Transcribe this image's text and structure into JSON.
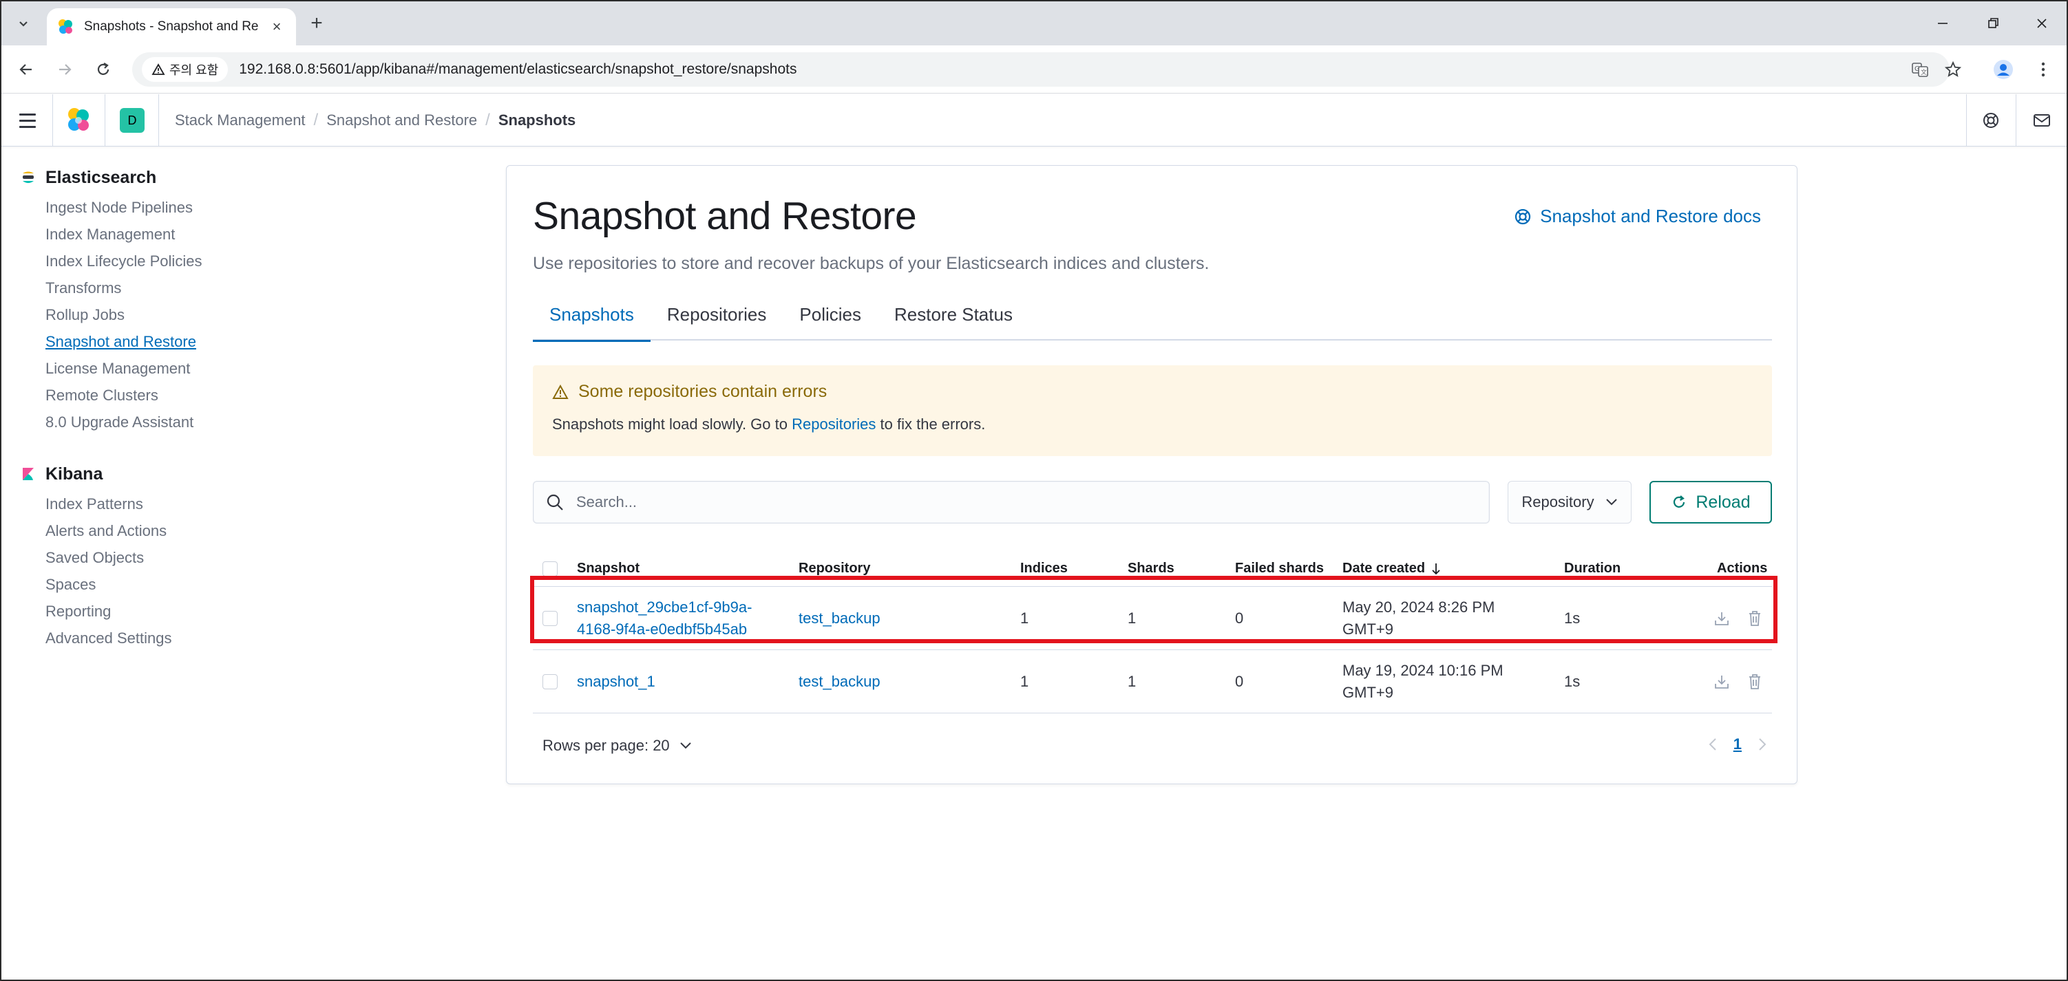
{
  "browser": {
    "tab_title": "Snapshots - Snapshot and Re",
    "warning_label": "주의 요함",
    "url": "192.168.0.8:5601/app/kibana#/management/elasticsearch/snapshot_restore/snapshots"
  },
  "header": {
    "space_initial": "D",
    "breadcrumbs": [
      "Stack Management",
      "Snapshot and Restore",
      "Snapshots"
    ]
  },
  "sidenav": {
    "groups": [
      {
        "title": "Elasticsearch",
        "items": [
          "Ingest Node Pipelines",
          "Index Management",
          "Index Lifecycle Policies",
          "Transforms",
          "Rollup Jobs",
          "Snapshot and Restore",
          "License Management",
          "Remote Clusters",
          "8.0 Upgrade Assistant"
        ],
        "active_item": "Snapshot and Restore"
      },
      {
        "title": "Kibana",
        "items": [
          "Index Patterns",
          "Alerts and Actions",
          "Saved Objects",
          "Spaces",
          "Reporting",
          "Advanced Settings"
        ]
      }
    ]
  },
  "main": {
    "title": "Snapshot and Restore",
    "docs_link": "Snapshot and Restore docs",
    "description": "Use repositories to store and recover backups of your Elasticsearch indices and clusters.",
    "tabs": [
      "Snapshots",
      "Repositories",
      "Policies",
      "Restore Status"
    ],
    "selected_tab": "Snapshots",
    "callout": {
      "title": "Some repositories contain errors",
      "body_before": "Snapshots might load slowly. Go to",
      "link": "Repositories",
      "body_after": "to fix the errors."
    },
    "search": {
      "placeholder": "Search..."
    },
    "filter_label": "Repository",
    "reload_label": "Reload",
    "table": {
      "columns": [
        "Snapshot",
        "Repository",
        "Indices",
        "Shards",
        "Failed shards",
        "Date created",
        "Duration",
        "Actions"
      ],
      "sorted_column": "Date created",
      "rows": [
        {
          "snapshot_line1": "snapshot_29cbe1cf-9b9a-",
          "snapshot_line2": "4168-9f4a-e0edbf5b45ab",
          "repository": "test_backup",
          "indices": "1",
          "shards": "1",
          "failed": "0",
          "date_line1": "May 20, 2024 8:26 PM",
          "date_line2": "GMT+9",
          "duration": "1s",
          "highlighted": true
        },
        {
          "snapshot_line1": "snapshot_1",
          "snapshot_line2": "",
          "repository": "test_backup",
          "indices": "1",
          "shards": "1",
          "failed": "0",
          "date_line1": "May 19, 2024 10:16 PM",
          "date_line2": "GMT+9",
          "duration": "1s",
          "highlighted": false
        }
      ]
    },
    "pagination": {
      "rows_per_page": "Rows per page: 20",
      "current_page": "1"
    }
  },
  "colors": {
    "primary": "#006bb8",
    "success": "#017d73",
    "warning_bg": "#fef6e6",
    "highlight_box": "#e3131d"
  }
}
